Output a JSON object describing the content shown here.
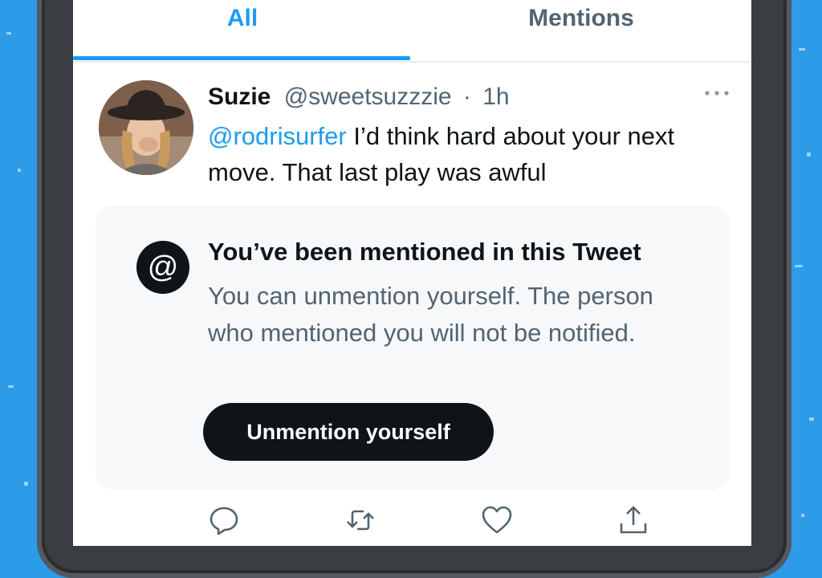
{
  "tabs": [
    {
      "label": "All",
      "active": true
    },
    {
      "label": "Mentions",
      "active": false
    }
  ],
  "tweet": {
    "name": "Suzie",
    "handle": "@sweetsuzzzie",
    "separator": "·",
    "time": "1h",
    "mention": "@rodrisurfer",
    "text": " I’d think hard about your next move. That last play was awful"
  },
  "notice": {
    "icon_char": "@",
    "title": "You’ve been mentioned in this Tweet",
    "body": "You can unmention yourself. The person who mentioned you will not be notified.",
    "button_label": "Unmention yourself"
  },
  "actions": [
    "reply-icon",
    "retweet-icon",
    "like-icon",
    "share-icon"
  ],
  "colors": {
    "accent": "#1d9bf0",
    "text_primary": "#0f1419",
    "text_secondary": "#536471",
    "background_blue": "#2c9be8",
    "notice_bg": "#f6f8fa"
  }
}
